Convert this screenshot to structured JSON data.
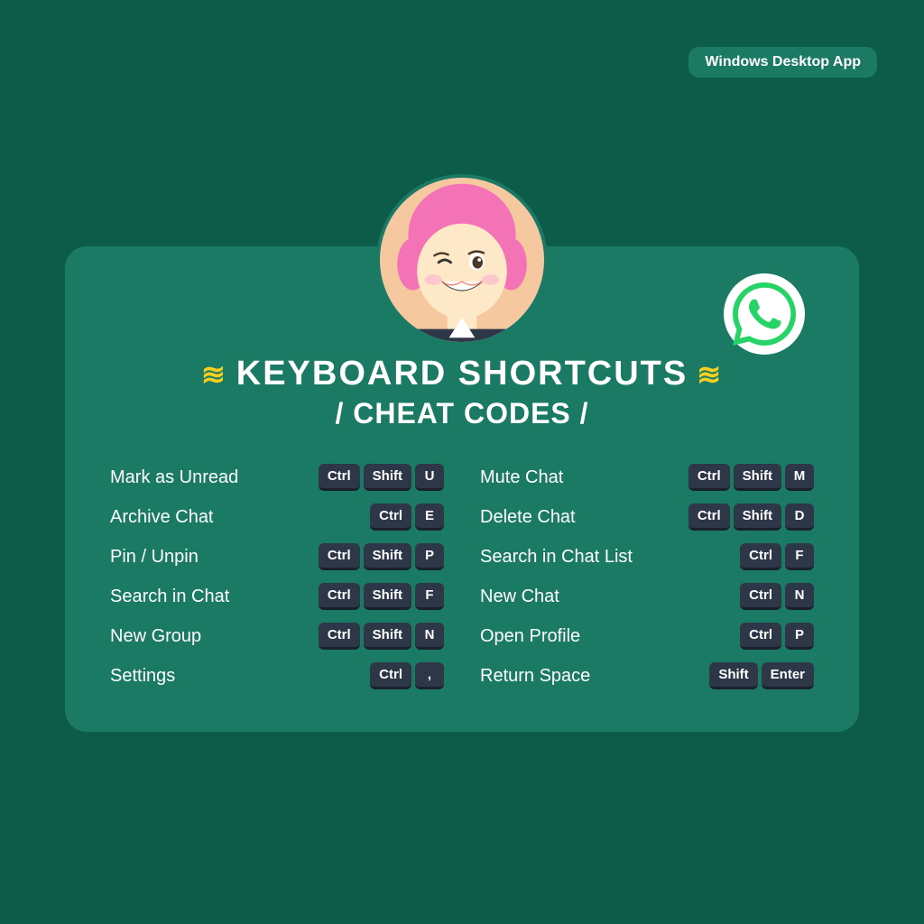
{
  "platform": {
    "badge": "Windows Desktop App"
  },
  "title": {
    "line1": "KEYBOARD SHORTCUTS",
    "line2": "/ CHEAT CODES /",
    "sparkle_left": "✦",
    "sparkle_right": "✦"
  },
  "shortcuts_left": [
    {
      "label": "Mark as Unread",
      "keys": [
        "Ctrl",
        "Shift",
        "U"
      ]
    },
    {
      "label": "Archive Chat",
      "keys": [
        "Ctrl",
        "E"
      ]
    },
    {
      "label": "Pin / Unpin",
      "keys": [
        "Ctrl",
        "Shift",
        "P"
      ]
    },
    {
      "label": "Search in Chat",
      "keys": [
        "Ctrl",
        "Shift",
        "F"
      ]
    },
    {
      "label": "New Group",
      "keys": [
        "Ctrl",
        "Shift",
        "N"
      ]
    },
    {
      "label": "Settings",
      "keys": [
        "Ctrl",
        ","
      ]
    }
  ],
  "shortcuts_right": [
    {
      "label": "Mute Chat",
      "keys": [
        "Ctrl",
        "Shift",
        "M"
      ]
    },
    {
      "label": "Delete Chat",
      "keys": [
        "Ctrl",
        "Shift",
        "D"
      ]
    },
    {
      "label": "Search in Chat List",
      "keys": [
        "Ctrl",
        "F"
      ]
    },
    {
      "label": "New Chat",
      "keys": [
        "Ctrl",
        "N"
      ]
    },
    {
      "label": "Open Profile",
      "keys": [
        "Ctrl",
        "P"
      ]
    },
    {
      "label": "Return Space",
      "keys": [
        "Shift",
        "Enter"
      ]
    }
  ]
}
